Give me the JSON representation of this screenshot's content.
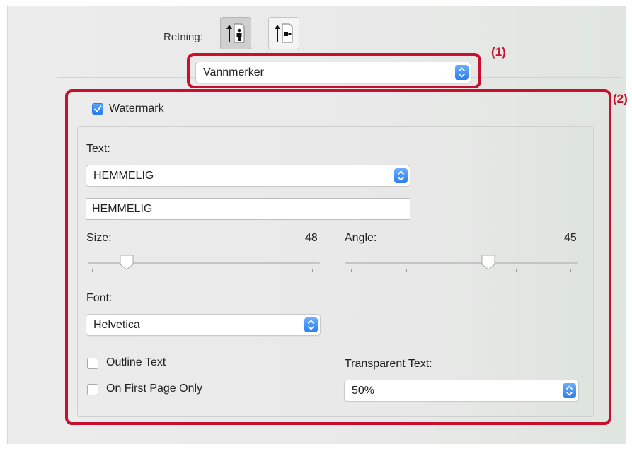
{
  "orientation": {
    "label": "Retning:"
  },
  "panel_menu": {
    "value": "Vannmerker"
  },
  "callouts": {
    "one": "(1)",
    "two": "(2)"
  },
  "watermark": {
    "enabled_label": "Watermark",
    "text_label": "Text:",
    "text_select_value": "HEMMELIG",
    "text_field_value": "HEMMELIG",
    "size_label": "Size:",
    "size_value": "48",
    "angle_label": "Angle:",
    "angle_value": "45",
    "font_label": "Font:",
    "font_value": "Helvetica",
    "outline_label": "Outline Text",
    "first_page_label": "On First Page Only",
    "transparent_label": "Transparent Text:",
    "transparent_value": "50%"
  },
  "colors": {
    "accent": "#2a7ef1",
    "callout": "#c8102e"
  },
  "icons": [
    "portrait-orientation-icon",
    "landscape-orientation-icon",
    "popup-stepper-icon",
    "checkmark-icon",
    "slider-knob-icon"
  ]
}
